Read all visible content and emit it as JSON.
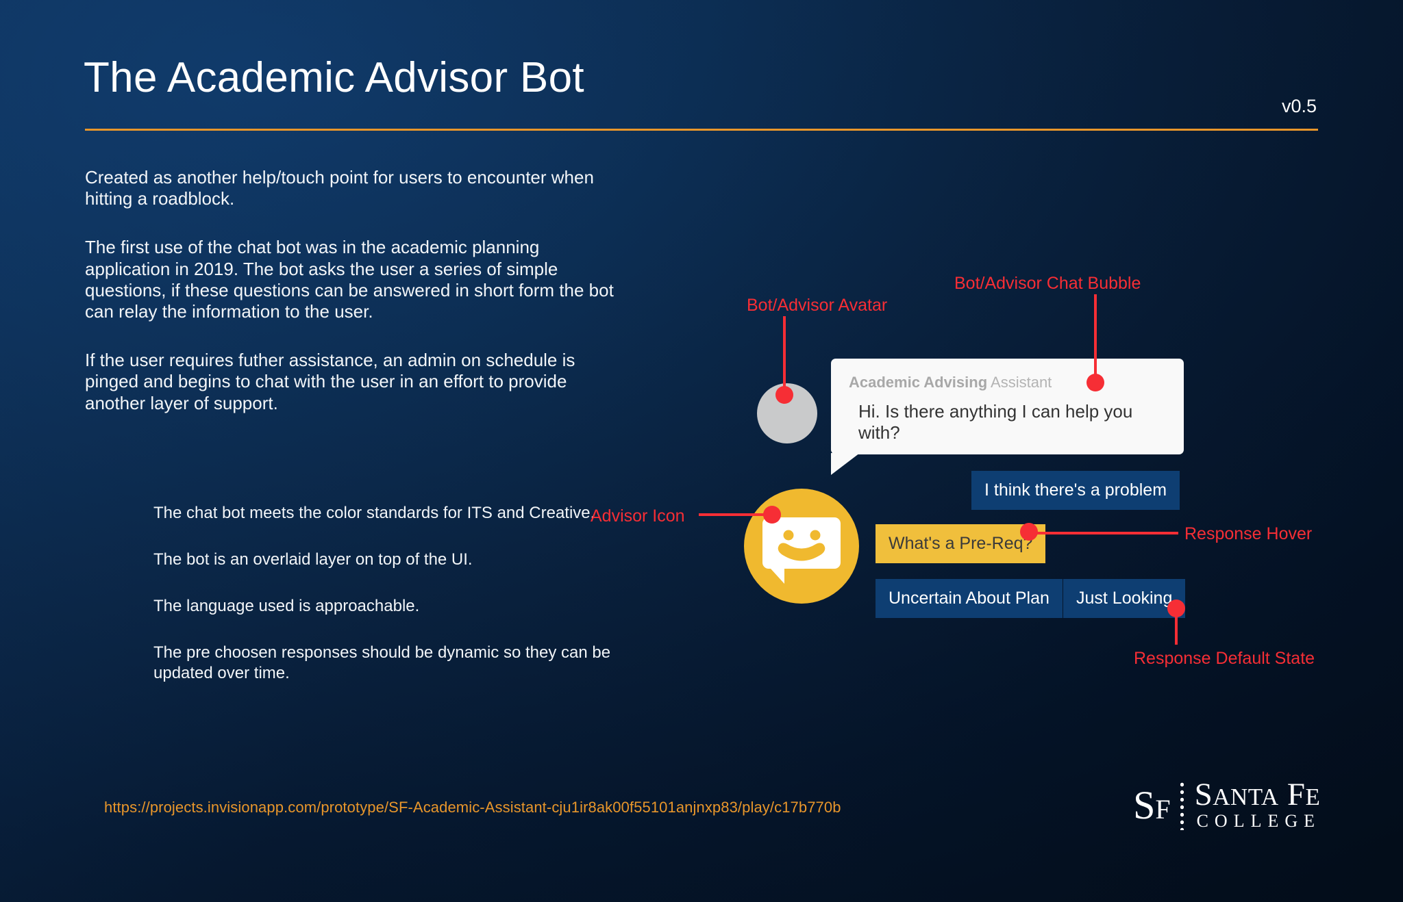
{
  "header": {
    "title": "The Academic Advisor Bot",
    "version": "v0.5"
  },
  "copy": {
    "paragraphs": [
      "Created as another help/touch point for users to encounter when hitting a roadblock.",
      "The first use of the chat bot was in the academic planning application in 2019. The bot asks the user a series of simple questions, if these questions can be answered in short form the bot can relay the information to the user.",
      "If the user requires futher assistance, an admin on schedule is pinged and begins to chat with the user in an effort to provide another layer of support."
    ],
    "bullets": [
      "The chat bot meets the color standards for ITS and Creative.",
      "The bot is an overlaid layer on top of the UI.",
      "The language used is approachable.",
      "The pre choosen responses should be dynamic so they can be updated over time."
    ]
  },
  "chat": {
    "bubble_title_strong": "Academic Advising",
    "bubble_title_rest": " Assistant",
    "bubble_message": "Hi. Is there anything I can help you with?",
    "responses": [
      {
        "label": "I think there's a problem",
        "state": "default"
      },
      {
        "label": "What's a Pre-Req?",
        "state": "hover"
      },
      {
        "label": "Uncertain About Plan",
        "state": "default"
      },
      {
        "label": "Just Looking",
        "state": "default"
      }
    ]
  },
  "annotations": [
    {
      "label": "Bot/Advisor Avatar"
    },
    {
      "label": "Bot/Advisor Chat Bubble"
    },
    {
      "label": "Advisor Icon"
    },
    {
      "label": "Response Hover"
    },
    {
      "label": "Response Default State"
    }
  ],
  "footer": {
    "prototype_url": "https://projects.invisionapp.com/prototype/SF-Academic-Assistant-cju1ir8ak00f55101anjnxp83/play/c17b770b",
    "logo": {
      "mark_s": "S",
      "mark_f": "F",
      "name_santa_cap": "S",
      "name_santa_rest": "ANTA",
      "name_fe_cap": "F",
      "name_fe_rest": "E",
      "subtitle": "COLLEGE"
    }
  },
  "colors": {
    "background_deep": "#04101f",
    "background_mid": "#0c2d52",
    "accent_orange": "#e8962b",
    "annotation_red": "#f62e35",
    "response_blue": "#0e3e72",
    "response_hover_yellow": "#f0bf3c",
    "advisor_icon_yellow": "#f0b92f",
    "avatar_gray": "#c9cacb",
    "bubble_white": "#f9f9f9"
  }
}
